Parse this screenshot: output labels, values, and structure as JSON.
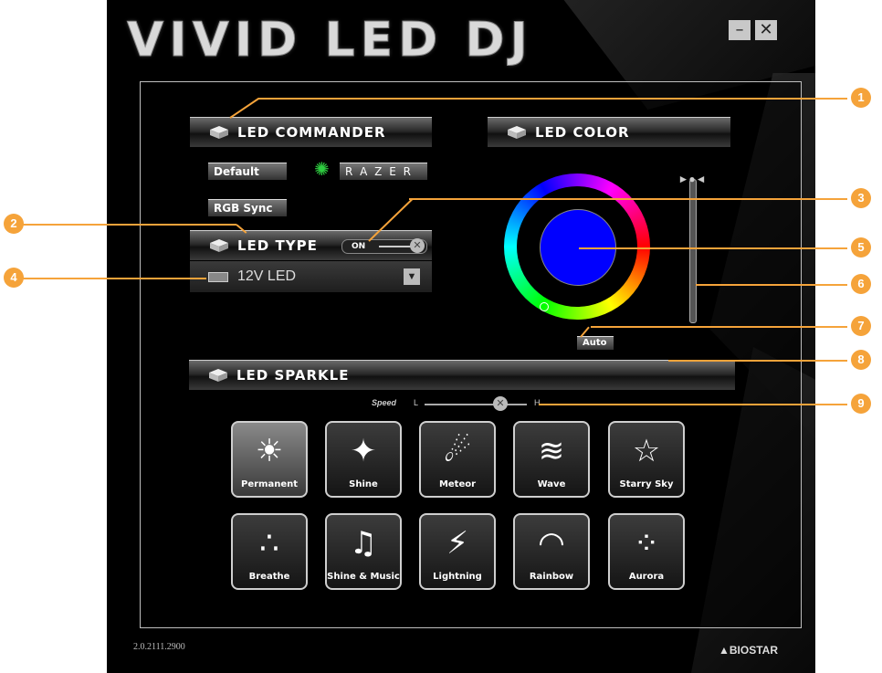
{
  "app": {
    "title": "VIVID LED DJ",
    "minimize_label": "–",
    "close_label": "✕",
    "version": "2.0.2111.2900",
    "brand": "BIOSTAR"
  },
  "commander": {
    "header": "LED COMMANDER",
    "default_label": "Default",
    "razer_label": "R A Z E R",
    "rgb_sync_label": "RGB Sync"
  },
  "led_type": {
    "header": "LED TYPE",
    "toggle_label": "ON",
    "selected": "12V LED"
  },
  "led_color": {
    "header": "LED COLOR",
    "selected_color": "#0000ff",
    "auto_label": "Auto"
  },
  "sparkle": {
    "header": "LED SPARKLE",
    "speed_label": "Speed",
    "speed_low": "L",
    "speed_high": "H",
    "effects": [
      {
        "label": "Permanent",
        "icon": "sun-icon",
        "glyph": "☀"
      },
      {
        "label": "Shine",
        "icon": "sparkle-icon",
        "glyph": "✦"
      },
      {
        "label": "Meteor",
        "icon": "meteor-icon",
        "glyph": "☄"
      },
      {
        "label": "Wave",
        "icon": "wave-icon",
        "glyph": "≋"
      },
      {
        "label": "Starry Sky",
        "icon": "stars-icon",
        "glyph": "☆"
      },
      {
        "label": "Breathe",
        "icon": "breathe-icon",
        "glyph": "∴"
      },
      {
        "label": "Shine & Music",
        "icon": "music-icon",
        "glyph": "♫"
      },
      {
        "label": "Lightning",
        "icon": "lightning-icon",
        "glyph": "⚡"
      },
      {
        "label": "Rainbow",
        "icon": "rainbow-icon",
        "glyph": "◠"
      },
      {
        "label": "Aurora",
        "icon": "aurora-icon",
        "glyph": "⁘"
      }
    ]
  },
  "callouts": [
    "1",
    "2",
    "3",
    "4",
    "5",
    "6",
    "7",
    "8",
    "9"
  ],
  "colors": {
    "accent": "#f5a33a",
    "panel_border": "#bfbfbf"
  }
}
